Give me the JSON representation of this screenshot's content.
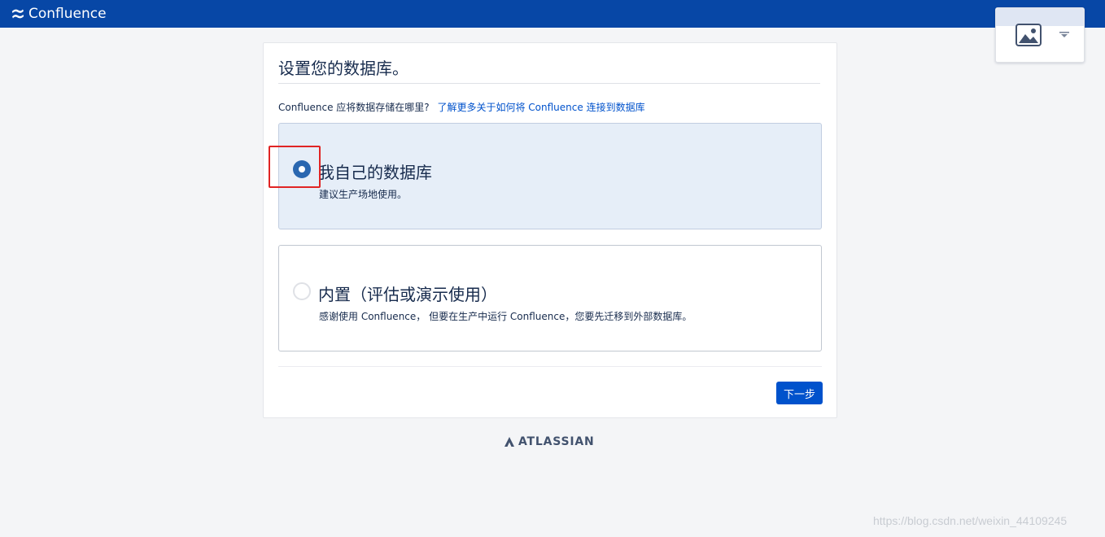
{
  "header": {
    "brand_name": "Confluence",
    "logo_icon": "confluence-logo-icon",
    "bg_color": "#0747a6"
  },
  "image_widget": {
    "image_icon": "image-icon",
    "caret_icon": "caret-down-icon"
  },
  "setup": {
    "title": "设置您的数据库。",
    "question": "Confluence 应将数据存储在哪里?",
    "learn_more_link": "了解更多关于如何将 Confluence 连接到数据库",
    "options": [
      {
        "title": "我自己的数据库",
        "description": "建议生产场地使用。",
        "selected": true
      },
      {
        "title": "内置（评估或演示使用）",
        "description": "感谢使用 Confluence， 但要在生产中运行 Confluence，您要先迁移到外部数据库。",
        "selected": false
      }
    ],
    "next_button": "下一步",
    "accent_color": "#0052cc"
  },
  "footer": {
    "atlassian_name": "ATLASSIAN",
    "atlassian_icon": "atlassian-logo-icon"
  },
  "watermark": "https://blog.csdn.net/weixin_44109245"
}
